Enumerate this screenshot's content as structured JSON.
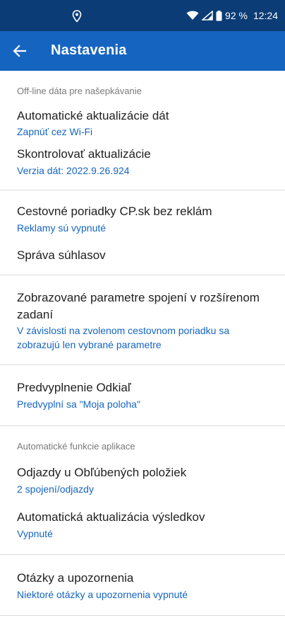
{
  "status_bar": {
    "battery": "92 %",
    "time": "12:24",
    "icons": [
      "location-icon",
      "wifi-icon",
      "signal-icon",
      "battery-icon"
    ]
  },
  "app_bar": {
    "title": "Nastavenia",
    "back_icon": "arrow-back-icon"
  },
  "colors": {
    "status_bar": "#0b3c75",
    "app_bar": "#1565c0",
    "subtitle_accent": "#1565c0",
    "section_header": "#7a7a7a",
    "divider": "#dcdcdc"
  },
  "sections": [
    {
      "header": "Off-line dáta pre našepkávanie",
      "items": [
        {
          "title": "Automatické aktualizácie dát",
          "subtitle": "Zapnúť cez Wi-Fi"
        },
        {
          "title": "Skontrolovať aktualizácie",
          "subtitle": "Verzia dát: 2022.9.26.924"
        }
      ]
    },
    {
      "items": [
        {
          "title": "Cestovné poriadky CP.sk bez reklám",
          "subtitle": "Reklamy sú vypnuté"
        },
        {
          "title": "Správa súhlasov"
        }
      ]
    },
    {
      "items": [
        {
          "title_line1": "Zobrazované parametre spojení v rozšírenom",
          "title_line2": "zadaní",
          "subtitle_line1": "V závislosti na zvolenom cestovnom poriadku sa",
          "subtitle_line2": "zobrazujú len vybrané parametre"
        }
      ]
    },
    {
      "items": [
        {
          "title": "Predvyplnenie Odkiaľ",
          "subtitle": "Predvyplní sa \"Moja poloha\""
        }
      ]
    },
    {
      "header": "Automatické funkcie aplikace",
      "items": [
        {
          "title": "Odjazdy u Obľúbených položiek",
          "subtitle": "2 spojení/odjazdy"
        },
        {
          "title": "Automatická aktualizácia výsledkov",
          "subtitle": "Vypnuté"
        }
      ]
    },
    {
      "items": [
        {
          "title": "Otázky a upozornenia",
          "subtitle": "Niektoré otázky a upozornenia vypnuté"
        }
      ]
    }
  ]
}
